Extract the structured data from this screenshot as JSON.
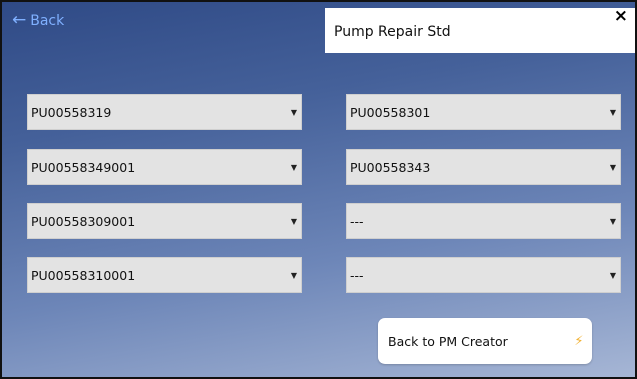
{
  "header": {
    "back_label": "Back",
    "back_icon": "left-arrow",
    "title": "Pump Repair Std",
    "close_glyph": "×"
  },
  "selects": {
    "left": [
      {
        "value": "PU00558319"
      },
      {
        "value": "PU00558349001"
      },
      {
        "value": "PU00558309001"
      },
      {
        "value": "PU00558310001"
      }
    ],
    "right": [
      {
        "value": "PU00558301"
      },
      {
        "value": "PU00558343"
      },
      {
        "value": "---"
      },
      {
        "value": "---"
      }
    ]
  },
  "footer": {
    "back_to_creator_label": "Back to PM Creator",
    "icon": "lightning-bolt"
  },
  "colors": {
    "back_link": "#7fb0ff",
    "bolt": "#f2b233"
  }
}
